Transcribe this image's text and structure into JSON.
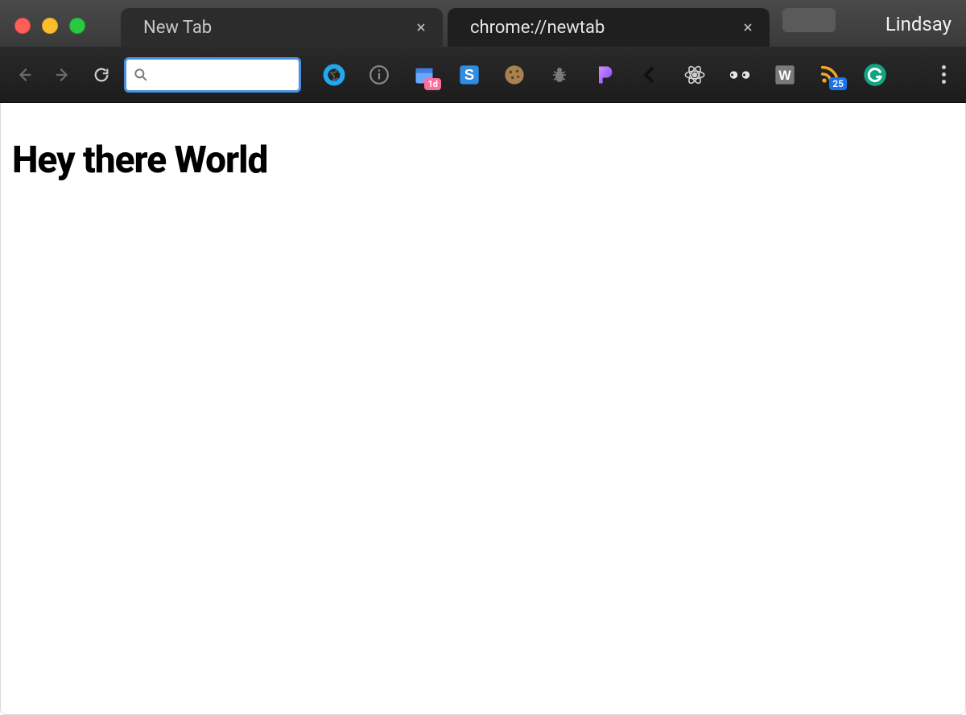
{
  "window": {
    "traffic_lights": [
      "close",
      "minimize",
      "zoom"
    ]
  },
  "tabs": [
    {
      "title": "New Tab",
      "active": false
    },
    {
      "title": "chrome://newtab",
      "active": true
    }
  ],
  "profile": {
    "name": "Lindsay"
  },
  "toolbar": {
    "back_disabled": true,
    "forward_disabled": true,
    "omnibox_value": "",
    "omnibox_placeholder": ""
  },
  "extensions": [
    {
      "id": "ext-blue-ring",
      "icon": "blue-ring-icon"
    },
    {
      "id": "ext-info",
      "icon": "info-icon"
    },
    {
      "id": "ext-calendar",
      "icon": "calendar-icon",
      "badge_pink": "1d"
    },
    {
      "id": "ext-s",
      "icon": "s-square-icon"
    },
    {
      "id": "ext-cookie",
      "icon": "cookie-icon"
    },
    {
      "id": "ext-bug",
      "icon": "bug-icon"
    },
    {
      "id": "ext-pandora",
      "icon": "pandora-icon"
    },
    {
      "id": "ext-chevron",
      "icon": "chevron-left-icon"
    },
    {
      "id": "ext-react",
      "icon": "react-icon"
    },
    {
      "id": "ext-glasses",
      "icon": "glasses-icon"
    },
    {
      "id": "ext-w",
      "icon": "w-square-icon"
    },
    {
      "id": "ext-rss",
      "icon": "rss-icon",
      "badge": "25"
    },
    {
      "id": "ext-grammarly",
      "icon": "grammarly-icon"
    }
  ],
  "page": {
    "heading": "Hey there World"
  }
}
